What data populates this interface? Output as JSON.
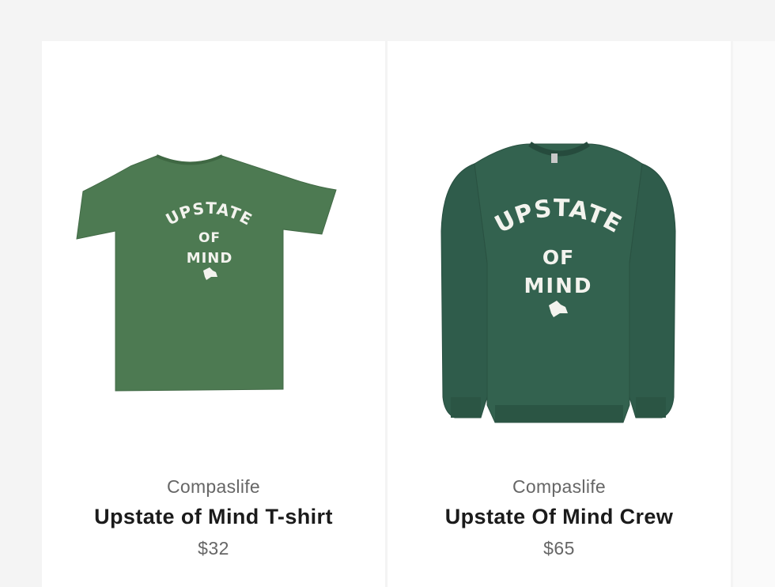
{
  "colors": {
    "page_background": "#f4f4f4",
    "card_background": "#ffffff",
    "tshirt_green": "#4d7a52",
    "crew_green": "#2f5c4b",
    "print_white": "#f3f3ee"
  },
  "products": [
    {
      "vendor": "Compaslife",
      "title": "Upstate of Mind T-shirt",
      "price": "$32",
      "image": {
        "type": "t-shirt",
        "print_line1": "UPSTATE",
        "print_line2": "OF",
        "print_line3": "MIND"
      }
    },
    {
      "vendor": "Compaslife",
      "title": "Upstate Of Mind Crew",
      "price": "$65",
      "image": {
        "type": "crewneck-sweatshirt",
        "print_line1": "UPSTATE",
        "print_line2": "OF",
        "print_line3": "MIND"
      }
    }
  ]
}
